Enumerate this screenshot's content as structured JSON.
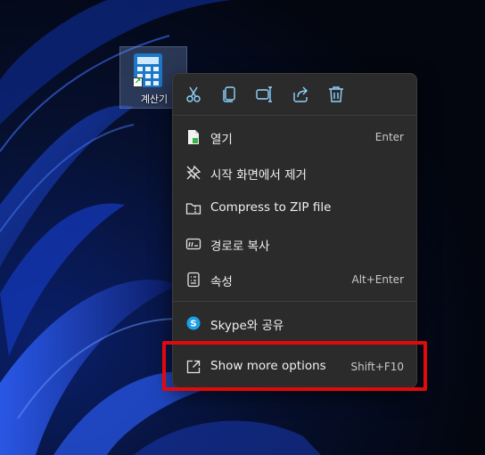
{
  "colors": {
    "menu_bg": "#2b2b2b",
    "accent": "#4cc2ff",
    "highlight_box": "#e10a0a",
    "skype": "#1da1e6"
  },
  "desktop": {
    "icon_label": "계산기",
    "icon_name": "calculator-icon"
  },
  "context_menu": {
    "toolbar": [
      {
        "name": "cut-icon"
      },
      {
        "name": "copy-icon"
      },
      {
        "name": "rename-icon"
      },
      {
        "name": "share-icon"
      },
      {
        "name": "delete-icon"
      }
    ],
    "items": [
      {
        "label": "열기",
        "shortcut": "Enter",
        "icon": "open-file-icon"
      },
      {
        "label": "시작 화면에서 제거",
        "shortcut": "",
        "icon": "unpin-icon"
      },
      {
        "label": "Compress to ZIP file",
        "shortcut": "",
        "icon": "zip-folder-icon"
      },
      {
        "label": "경로로 복사",
        "shortcut": "",
        "icon": "copy-path-icon"
      },
      {
        "label": "속성",
        "shortcut": "Alt+Enter",
        "icon": "properties-icon"
      },
      {
        "label": "Skype와 공유",
        "shortcut": "",
        "icon": "skype-icon"
      },
      {
        "label": "Show more options",
        "shortcut": "Shift+F10",
        "icon": "show-more-icon"
      }
    ]
  }
}
